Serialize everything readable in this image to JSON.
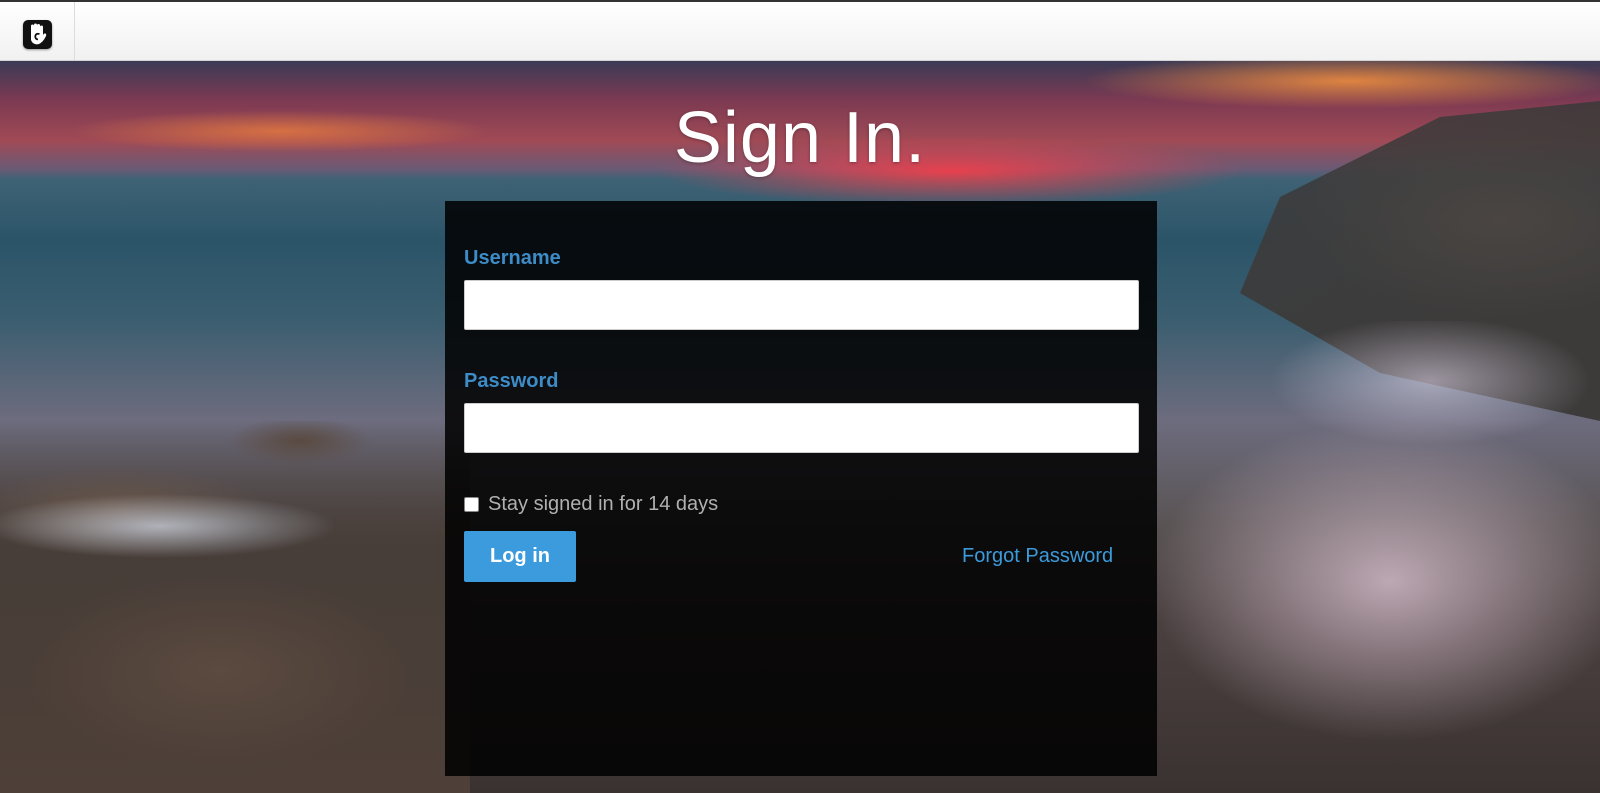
{
  "header": {
    "logo_icon": "concrete5-hand-logo-icon"
  },
  "page": {
    "title": "Sign In."
  },
  "form": {
    "username_label": "Username",
    "username_value": "",
    "password_label": "Password",
    "password_value": "",
    "remember_label": "Stay signed in for 14 days",
    "remember_checked": false,
    "login_button": "Log in",
    "forgot_link": "Forgot Password"
  },
  "colors": {
    "accent": "#3b9bdc",
    "label": "#3d8cc7",
    "panel": "#000000"
  }
}
